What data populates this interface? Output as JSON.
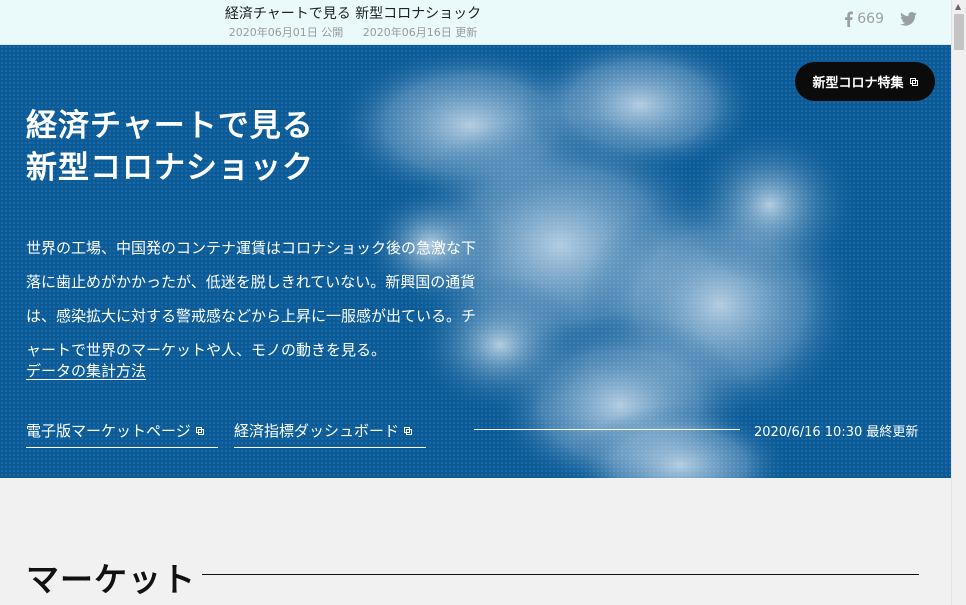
{
  "topbar": {
    "title": "経済チャートで見る 新型コロナショック",
    "published": "2020年06月01日 公開",
    "updated": "2020年06月16日 更新",
    "facebook_count": "669"
  },
  "hero": {
    "special_button": "新型コロナ特集",
    "headline_line1": "経済チャートで見る",
    "headline_line2": "新型コロナショック",
    "lead_line1": "世界の工場、中国発のコンテナ運賃はコロナショック後の急激な下",
    "lead_line2": "落に歯止めがかかったが、低迷を脱しきれていない。新興国の通貨",
    "lead_line3": "は、感染拡大に対する警戒感などから上昇に一服感が出ている。チ",
    "lead_line4": "ャートで世界のマーケットや人、モノの動きを見る。",
    "method_link": "データの集計方法",
    "market_page_link": "電子版マーケットページ",
    "dashboard_link": "経済指標ダッシュボード",
    "last_updated": "2020/6/16 10:30 最終更新"
  },
  "section": {
    "market_title": "マーケット"
  },
  "colors": {
    "topbar_bg": "#eafafb",
    "hero_bg": "#0a5b98",
    "button_bg": "#0b0b0b"
  }
}
